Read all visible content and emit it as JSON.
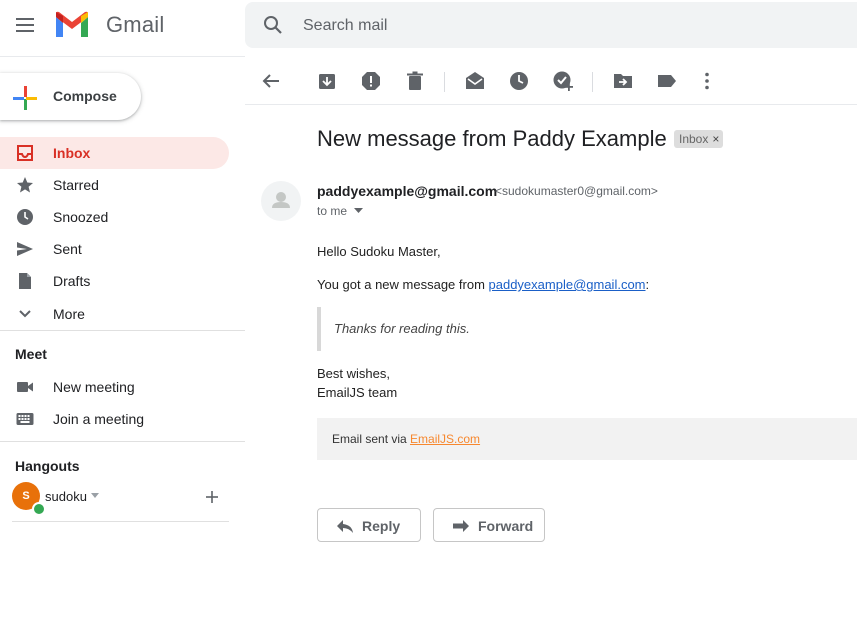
{
  "header": {
    "brand": "Gmail",
    "search_placeholder": "Search mail"
  },
  "sidebar": {
    "compose_label": "Compose",
    "items": [
      {
        "label": "Inbox",
        "icon": "inbox-icon",
        "active": true
      },
      {
        "label": "Starred",
        "icon": "star-icon"
      },
      {
        "label": "Snoozed",
        "icon": "clock-icon"
      },
      {
        "label": "Sent",
        "icon": "send-icon"
      },
      {
        "label": "Drafts",
        "icon": "draft-icon"
      },
      {
        "label": "More",
        "icon": "chevron-down-icon"
      }
    ],
    "meet": {
      "title": "Meet",
      "items": [
        {
          "label": "New meeting",
          "icon": "video-icon"
        },
        {
          "label": "Join a meeting",
          "icon": "keyboard-icon"
        }
      ]
    },
    "hangouts": {
      "title": "Hangouts",
      "user_initial": "S",
      "user_name": "sudoku"
    }
  },
  "toolbar": {
    "icons": [
      "back-arrow-icon",
      "archive-icon",
      "report-spam-icon",
      "delete-icon",
      "mark-unread-icon",
      "snooze-icon",
      "add-to-tasks-icon",
      "move-to-icon",
      "label-icon",
      "more-vert-icon"
    ]
  },
  "message": {
    "subject": "New message from Paddy Example",
    "label": "Inbox",
    "label_close": "×",
    "sender_name": "paddyexample@gmail.com",
    "sender_email": "<sudokumaster0@gmail.com>",
    "to": "to me",
    "greeting": "Hello Sudoku Master,",
    "line_prefix": "You got a new message from ",
    "line_link": "paddyexample@gmail.com",
    "line_suffix": ":",
    "quote": "Thanks for reading this.",
    "signoff_1": "Best wishes,",
    "signoff_2": "EmailJS team",
    "footer_prefix": "Email sent via ",
    "footer_link": "EmailJS.com"
  },
  "actions": {
    "reply": "Reply",
    "forward": "Forward"
  },
  "colors": {
    "active_bg": "#fce8e6",
    "active_text": "#d93025",
    "link": "#1a5fc7",
    "footer_link": "#f7882f",
    "avatar": "#e8710a",
    "presence": "#34a853"
  }
}
